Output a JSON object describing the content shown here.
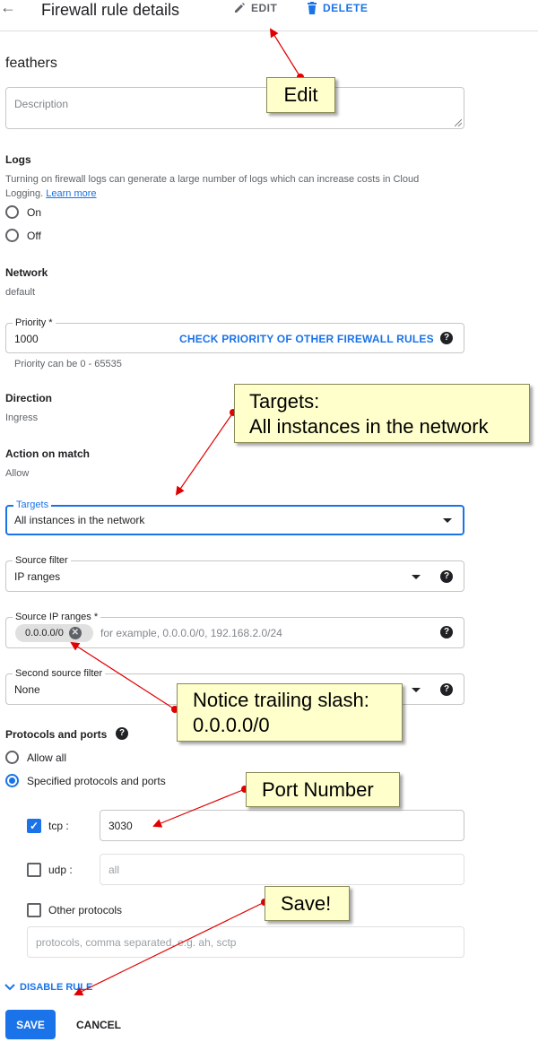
{
  "header": {
    "back_icon": "arrow-back-icon",
    "title": "Firewall rule details",
    "edit_label": "EDIT",
    "delete_label": "DELETE"
  },
  "rule_name": "feathers",
  "description": {
    "placeholder": "Description",
    "value": ""
  },
  "logs": {
    "label": "Logs",
    "help_text": "Turning on firewall logs can generate a large number of logs which can increase costs in Cloud",
    "help_text_2": "Logging.",
    "learn_more": "Learn more",
    "options": [
      "On",
      "Off"
    ]
  },
  "network": {
    "label": "Network",
    "value": "default"
  },
  "priority": {
    "label": "Priority *",
    "value": "1000",
    "check_link": "CHECK PRIORITY OF OTHER FIREWALL RULES",
    "hint": "Priority can be 0 - 65535"
  },
  "direction": {
    "label": "Direction",
    "value": "Ingress"
  },
  "action": {
    "label": "Action on match",
    "value": "Allow"
  },
  "targets": {
    "label": "Targets",
    "value": "All instances in the network"
  },
  "source_filter": {
    "label": "Source filter",
    "value": "IP ranges"
  },
  "source_ip_ranges": {
    "label": "Source IP ranges *",
    "chip": "0.0.0.0/0",
    "placeholder": "for example, 0.0.0.0/0, 192.168.2.0/24"
  },
  "second_source_filter": {
    "label": "Second source filter",
    "value": "None"
  },
  "protocols": {
    "label": "Protocols and ports",
    "allow_all": "Allow all",
    "specified": "Specified protocols and ports",
    "tcp_label": "tcp :",
    "tcp_value": "3030",
    "udp_label": "udp :",
    "udp_placeholder": "all",
    "other_label": "Other protocols",
    "other_placeholder": "protocols, comma separated, e.g. ah, sctp"
  },
  "disable_rule": "DISABLE RULE",
  "footer": {
    "save": "SAVE",
    "cancel": "CANCEL"
  },
  "annotations": {
    "edit": "Edit",
    "targets_1": "Targets:",
    "targets_2": "All instances in the network",
    "slash_1": "Notice trailing slash:",
    "slash_2": "0.0.0.0/0",
    "port": "Port Number",
    "save": "Save!"
  },
  "colors": {
    "accent": "#1a73e8",
    "callout_bg": "#ffffcc",
    "arrow": "#e00000"
  }
}
